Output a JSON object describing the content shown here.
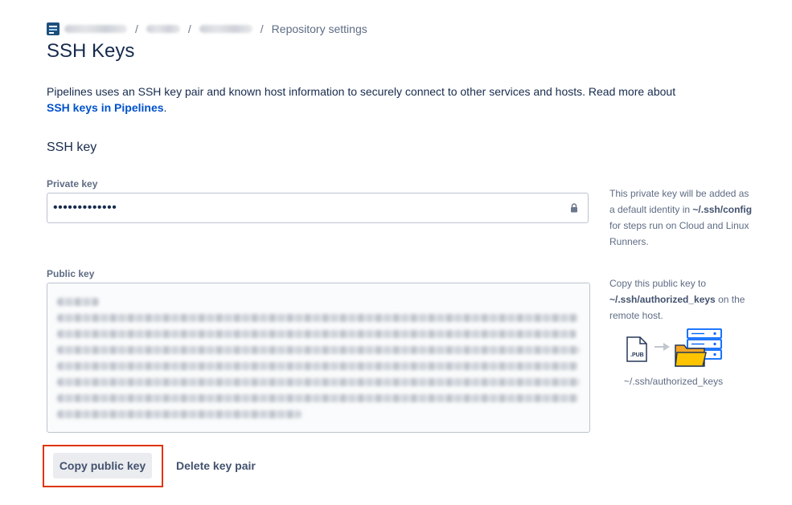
{
  "breadcrumb": {
    "current": "Repository settings",
    "separator": "/"
  },
  "page": {
    "title": "SSH Keys",
    "intro_text": "Pipelines uses an SSH key pair and known host information to securely connect to other services and hosts. Read more about ",
    "intro_link": "SSH keys in Pipelines",
    "intro_suffix": "."
  },
  "ssh_key": {
    "section_title": "SSH key",
    "private_key": {
      "label": "Private key",
      "masked_value": "•••••••••••••",
      "note_prefix": "This private key will be added as a default identity in ",
      "note_path": "~/.ssh/config",
      "note_suffix": " for steps run on Cloud and Linux Runners."
    },
    "public_key": {
      "label": "Public key",
      "note_prefix": "Copy this public key to ",
      "note_path": "~/.ssh/authorized_keys",
      "note_suffix": " on the remote host.",
      "illustration_caption": "~/.ssh/authorized_keys",
      "file_badge": ".PUB"
    }
  },
  "actions": {
    "copy_label": "Copy public key",
    "delete_label": "Delete key pair"
  },
  "colors": {
    "link": "#0052cc",
    "highlight": "#de350b",
    "folder": "#f6a623",
    "server": "#0065ff"
  }
}
